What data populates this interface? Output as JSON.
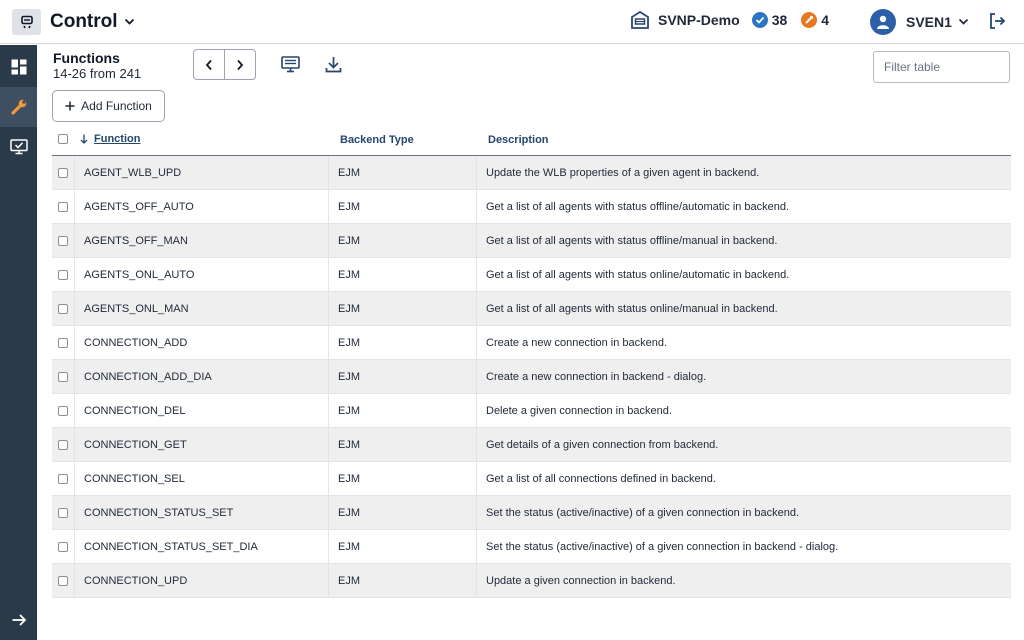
{
  "app": {
    "title": "Control"
  },
  "header": {
    "system_name": "SVNP-Demo",
    "ok_count": "38",
    "warning_count": "4",
    "user": "SVEN1"
  },
  "page": {
    "title": "Functions",
    "range": "14-26 from 241",
    "add_button": "Add Function",
    "filter_placeholder": "Filter table"
  },
  "table": {
    "columns": {
      "function": "Function",
      "backend_type": "Backend Type",
      "description": "Description"
    },
    "rows": [
      {
        "function": "AGENT_WLB_UPD",
        "backend": "EJM",
        "description": "Update the WLB properties of a given agent in backend."
      },
      {
        "function": "AGENTS_OFF_AUTO",
        "backend": "EJM",
        "description": "Get a list of all agents with status offline/automatic in backend."
      },
      {
        "function": "AGENTS_OFF_MAN",
        "backend": "EJM",
        "description": "Get a list of all agents with status offline/manual in backend."
      },
      {
        "function": "AGENTS_ONL_AUTO",
        "backend": "EJM",
        "description": "Get a list of all agents with status online/automatic in backend."
      },
      {
        "function": "AGENTS_ONL_MAN",
        "backend": "EJM",
        "description": "Get a list of all agents with status online/manual in backend."
      },
      {
        "function": "CONNECTION_ADD",
        "backend": "EJM",
        "description": "Create a new connection in backend."
      },
      {
        "function": "CONNECTION_ADD_DIA",
        "backend": "EJM",
        "description": "Create a new connection in backend - dialog."
      },
      {
        "function": "CONNECTION_DEL",
        "backend": "EJM",
        "description": "Delete a given connection in backend."
      },
      {
        "function": "CONNECTION_GET",
        "backend": "EJM",
        "description": "Get details of a given connection from backend."
      },
      {
        "function": "CONNECTION_SEL",
        "backend": "EJM",
        "description": "Get a list of all connections defined in backend."
      },
      {
        "function": "CONNECTION_STATUS_SET",
        "backend": "EJM",
        "description": "Set the status (active/inactive) of a given connection in backend."
      },
      {
        "function": "CONNECTION_STATUS_SET_DIA",
        "backend": "EJM",
        "description": "Set the status (active/inactive) of a given connection in backend - dialog."
      },
      {
        "function": "CONNECTION_UPD",
        "backend": "EJM",
        "description": "Update a given connection in backend."
      }
    ]
  },
  "icons": {
    "app_switch": "app-switch-icon",
    "chevron": "chevron-down-icon",
    "system": "building-icon",
    "ok": "check-circle-icon",
    "warning": "wrench-circle-icon",
    "user": "user-icon",
    "logout": "logout-icon",
    "dashboard": "dashboard-icon",
    "functions": "wrench-icon",
    "monitor": "monitor-check-icon",
    "expand": "arrow-right-icon",
    "prev": "chevron-left-icon",
    "next": "chevron-right-icon",
    "display": "display-icon",
    "download": "download-icon",
    "sort": "arrow-down-icon",
    "add": "plus-icon"
  },
  "colors": {
    "accent": "#2d74c4",
    "warning": "#e87722",
    "sidebar": "#2b3a48",
    "header_text": "#24466f"
  }
}
